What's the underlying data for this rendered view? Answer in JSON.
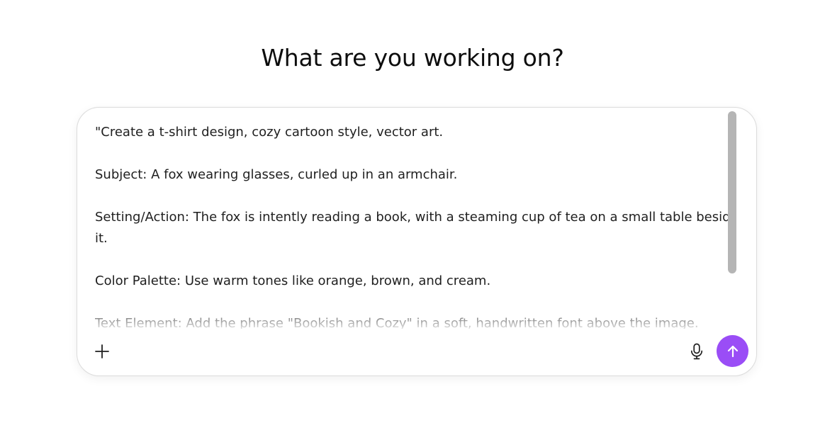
{
  "heading": "What are you working on?",
  "composer": {
    "prompt_lines": [
      "\"Create a t-shirt design, cozy cartoon style, vector art.",
      "",
      "Subject: A fox wearing glasses, curled up in an armchair.",
      "",
      "Setting/Action: The fox is intently reading a book, with a steaming cup of tea on a small table beside",
      "it.",
      "",
      "Color Palette: Use warm tones like orange, brown, and cream.",
      "",
      "Text Element: Add the phrase \"Bookish and Cozy\" in a soft, handwritten font above the image."
    ],
    "buttons": {
      "add_icon": "plus-icon",
      "mic_icon": "microphone-icon",
      "send_icon": "arrow-up-icon"
    },
    "colors": {
      "send_button": "#9a4df6",
      "border": "#dcdcdc",
      "scrollbar": "#b5b5b5"
    }
  }
}
